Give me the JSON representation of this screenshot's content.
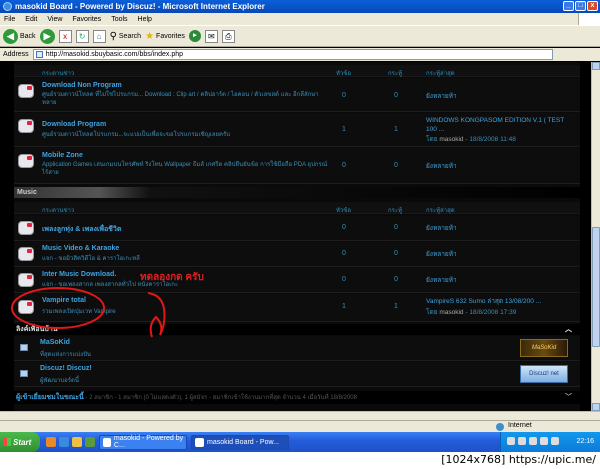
{
  "window": {
    "title": "masokid Board - Powered by Discuz! - Microsoft Internet Explorer"
  },
  "menu": [
    "File",
    "Edit",
    "View",
    "Favorites",
    "Tools",
    "Help"
  ],
  "toolbar": {
    "back": "Back",
    "search": "Search",
    "favorites": "Favorites"
  },
  "address": {
    "label": "Address",
    "url": "http://masokid.sbuybasic.com/bbs/index.php"
  },
  "columns": {
    "forum": "กระดานข่าว",
    "topics": "หัวข้อ",
    "posts": "กระทู้",
    "last": "กระทู้ล่าสุด"
  },
  "top_rows": [
    {
      "name": "Download Non Program",
      "desc": "ศูนย์รวมดาวน์โหลด ที่ไม่ใช่โปรแกรม... Download : Clip art / คลิปอาร์ต / ไอคอน / ตัวเลขสต์ และ อีกลีลักษาหลาย",
      "topics": "0",
      "posts": "0",
      "last": "ยังหลายห้า"
    },
    {
      "name": "Download Program",
      "desc": "ศูนย์รวมดาวน์โหลดโปรแกรม...จะแปแป็นเพื่อจะขอโปรแกรมเชิญเลยครับ",
      "topics": "1",
      "posts": "1",
      "last": "WINDOWS KONGPASOM EDITION V.1 ( TEST 100 ...",
      "by": "โดย",
      "author": "masokid",
      "time": "- 18/8/2008 11:48"
    },
    {
      "name": "Mobile Zone",
      "desc": "Application Games เล่นเกมบนโทรศัพท์ ริงโทน Wallpaper ธีมส์ เกศรีต คลิปยืนยันข้อ การใช้มือถือ PDA อุปกรณ์ไร้สาย",
      "topics": "0",
      "posts": "0",
      "last": "ยังหลายห้า"
    }
  ],
  "music_section": {
    "title": "Music"
  },
  "music_rows": [
    {
      "name": "เพลงลูกทุ่ง & เพลงเพื่อชีวิต",
      "desc": "",
      "topics": "0",
      "posts": "0",
      "last": "ยังหลายห้า"
    },
    {
      "name": "Music Video & Karaoke",
      "desc": "แจก - ขอมิวสิควิดีโอ & คาราโอเกะหลี",
      "topics": "0",
      "posts": "0",
      "last": "ยังหลายห้า"
    },
    {
      "name": "Inter Music Download.",
      "desc": "แจก - ขอเพลงสากล เพลงสากลทั่วไป หนังคาราโอเกะ",
      "topics": "0",
      "posts": "0",
      "last": "ยังหลายห้า"
    },
    {
      "name": "Vampire total",
      "desc": "รวมเพลงเปิดปุ่มเวท Vampire",
      "topics": "1",
      "posts": "1",
      "last": "VampireS 632 Sumo ล่าสุด 13/08/200 ...",
      "by": "โดย",
      "author": "masokid",
      "time": "- 18/8/2008 17:39"
    }
  ],
  "links": {
    "title": "ลิงค์เพื่อนบ้าน",
    "items": [
      {
        "name": "MaSoKid",
        "desc": "ที่สุดแห่งการแบ่งปัน",
        "banner": "MaSoKid"
      },
      {
        "name": "Discuz! Discuz!",
        "desc": "ผู้พัฒนาบอร์ดนี้",
        "banner": "Discuz! net"
      }
    ]
  },
  "online": {
    "title": "ผู้เข้าเยี่ยมชมในขณะนี้",
    "text": "- 2 สมาชิก - 1 สมาชิก (0 ไม่แสดงตัว), 1 ผู้สมัจร - สมาชิกเข้าใช้งานมากที่สุด จำนวน 4 เมื่อวันที่ 18/8/2008"
  },
  "annotation": "ทดลองกด ครับ",
  "status": {
    "zone": "Internet"
  },
  "taskbar": {
    "start": "Start",
    "tasks": [
      "masokid - Powered by C...",
      "masokid Board - Pow..."
    ],
    "clock": "22:16"
  },
  "caption": "[1024x768] https://upic.me/"
}
